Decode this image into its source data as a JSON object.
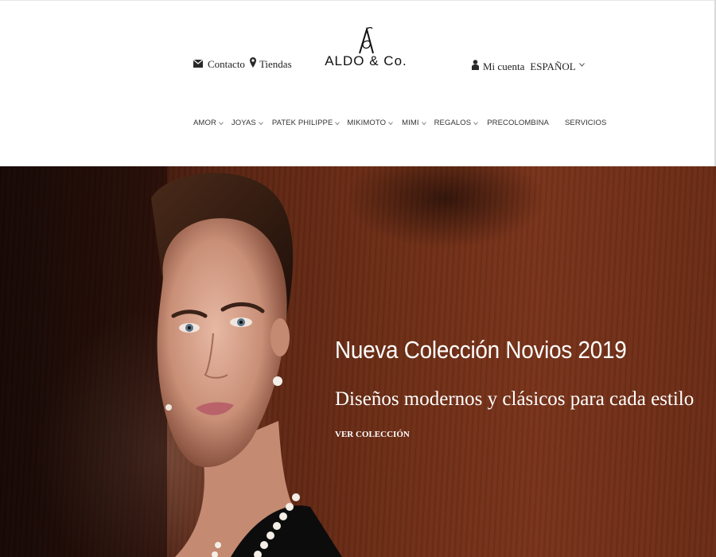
{
  "header": {
    "contact_label": "Contacto",
    "stores_label": "Tiendas",
    "logo_text": "ALDO & Co.",
    "logo_mark": "A",
    "account_label": "Mi cuenta",
    "language_label": "ESPAÑOL"
  },
  "nav": {
    "items": [
      {
        "label": "AMOR",
        "has_dropdown": true
      },
      {
        "label": "JOYAS",
        "has_dropdown": true
      },
      {
        "label": "PATEK PHILIPPE",
        "has_dropdown": true
      },
      {
        "label": "MIKIMOTO",
        "has_dropdown": true
      },
      {
        "label": "MIMI",
        "has_dropdown": true
      },
      {
        "label": "REGALOS",
        "has_dropdown": true
      },
      {
        "label": "PRECOLOMBINA",
        "has_dropdown": false
      },
      {
        "label": "SERVICIOS",
        "has_dropdown": false
      }
    ]
  },
  "hero": {
    "title": "Nueva Colección Novios 2019",
    "subtitle": "Diseños modernos y clásicos para cada estilo",
    "cta_label": "VER COLECCIÓN"
  },
  "icons": {
    "contact": "envelope-icon",
    "stores": "map-pin-icon",
    "account": "user-icon",
    "dropdown": "chevron-down-icon"
  },
  "colors": {
    "header_bg": "#ffffff",
    "text": "#222222",
    "hero_wood": "#6d2d15",
    "hero_text": "#ffffff"
  }
}
